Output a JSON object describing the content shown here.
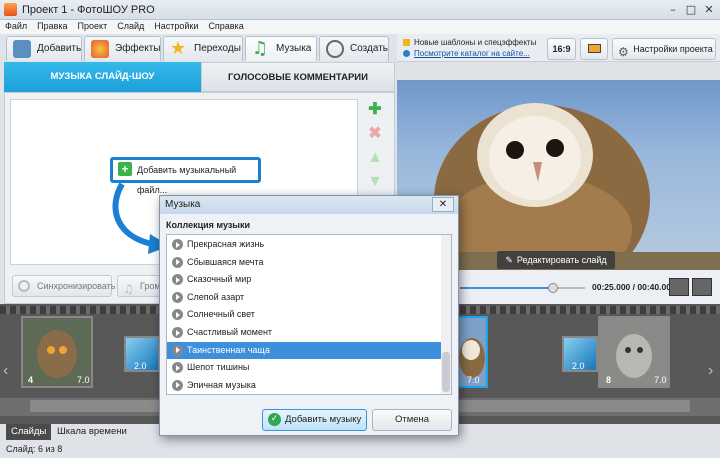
{
  "window": {
    "title": "Проект 1 - ФотоШОУ PRO"
  },
  "menu": [
    "Файл",
    "Правка",
    "Проект",
    "Слайд",
    "Настройки",
    "Справка"
  ],
  "tabs": [
    {
      "label": "Добавить",
      "icon": "photo-icon"
    },
    {
      "label": "Эффекты",
      "icon": "palette-icon"
    },
    {
      "label": "Переходы",
      "icon": "star-icon"
    },
    {
      "label": "Музыка",
      "icon": "music-note-icon"
    },
    {
      "label": "Создать",
      "icon": "film-reel-icon"
    }
  ],
  "music_panel": {
    "subtab_music": "МУЗЫКА СЛАЙД-ШОУ",
    "subtab_voice": "ГОЛОСОВЫЕ КОММЕНТАРИИ",
    "add_file": "Добавить музыкальный файл...",
    "sync": "Синхронизировать",
    "volume": "Гром"
  },
  "right_header": {
    "news": "Новые шаблоны и спецэффекты",
    "catalog": "Посмотрите каталог на сайте...",
    "ratio": "16:9",
    "settings": "Настройки проекта"
  },
  "preview": {
    "edit_slide": "Редактировать слайд",
    "time": "00:25.000 / 00:40.000",
    "progress": 0.62
  },
  "timeline": {
    "slides": [
      {
        "num": "4",
        "duration": "7.0"
      },
      {
        "num": "",
        "duration": "2.0"
      },
      {
        "num": "",
        "duration": "2.0"
      },
      {
        "num": "",
        "duration": "7.0"
      },
      {
        "num": "",
        "duration": "2.0"
      },
      {
        "num": "8",
        "duration": "7.0"
      }
    ],
    "tab_slides": "Слайды",
    "tab_timeline": "Шкала времени"
  },
  "status": "Слайд: 6 из 8",
  "dialog": {
    "title": "Музыка",
    "heading": "Коллекция музыки",
    "tracks": [
      "Прекрасная жизнь",
      "Сбывшаяся мечта",
      "Сказочный мир",
      "Слепой азарт",
      "Солнечный свет",
      "Счастливый момент",
      "Таинственная чаща",
      "Шепот тишины",
      "Эпичная музыка"
    ],
    "selected": "Таинственная чаща",
    "add": "Добавить музыку",
    "cancel": "Отмена"
  }
}
